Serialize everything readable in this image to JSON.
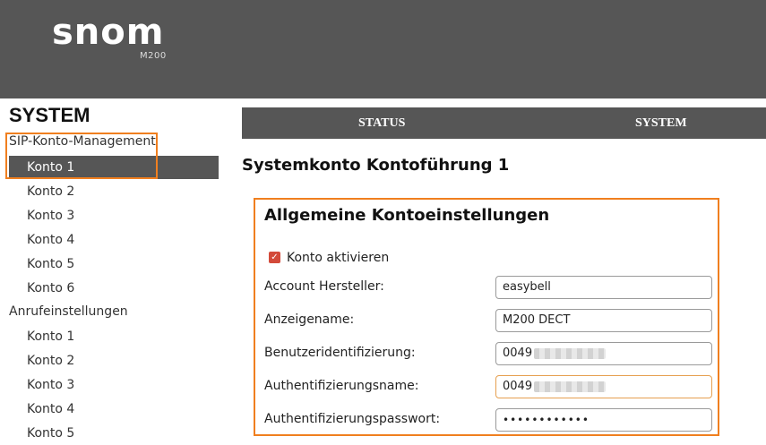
{
  "header": {
    "logo_text": "snom",
    "model": "M200"
  },
  "sidebar": {
    "title": "SYSTEM",
    "groups": [
      {
        "label": "SIP-Konto-Management",
        "items": [
          "Konto 1",
          "Konto 2",
          "Konto 3",
          "Konto 4",
          "Konto 5",
          "Konto 6"
        ],
        "active_index": 0
      },
      {
        "label": "Anrufeinstellungen",
        "items": [
          "Konto 1",
          "Konto 2",
          "Konto 3",
          "Konto 4",
          "Konto 5"
        ]
      }
    ]
  },
  "tabs": [
    "STATUS",
    "SYSTEM"
  ],
  "page_heading": "Systemkonto Kontoführung 1",
  "panel": {
    "title": "Allgemeine Kontoeinstellungen",
    "checkbox": {
      "label": "Konto aktivieren",
      "checked": true
    },
    "fields": [
      {
        "label": "Account Hersteller:",
        "value": "easybell"
      },
      {
        "label": "Anzeigename:",
        "value": "M200 DECT"
      },
      {
        "label": "Benutzeridentifizierung:",
        "value": "0049"
      },
      {
        "label": "Authentifizierungsname:",
        "value": "0049"
      },
      {
        "label": "Authentifizierungspasswort:",
        "value": "••••••••••••"
      }
    ]
  },
  "colors": {
    "header_bg": "#565656",
    "highlight": "#f07f1f",
    "checkbox": "#d34a3a"
  }
}
